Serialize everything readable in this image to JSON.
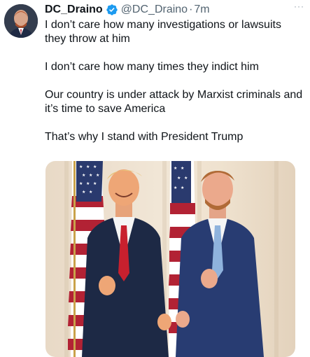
{
  "tweet": {
    "author_name": "DC_Draino",
    "handle": "@DC_Draino",
    "separator": "·",
    "time": "7m",
    "more_label": "···",
    "lines": [
      "I don’t care how many investigations or lawsuits they throw at him",
      "I don’t care how many times they indict him",
      "Our country is under attack by Marxist criminals and it’s time to save America",
      "That’s why I stand with President Trump"
    ]
  },
  "colors": {
    "verified": "#1d9bf0",
    "secondary_text": "#536471"
  },
  "icons": {
    "verified": "verified-badge-icon",
    "more": "more-dots-icon"
  }
}
